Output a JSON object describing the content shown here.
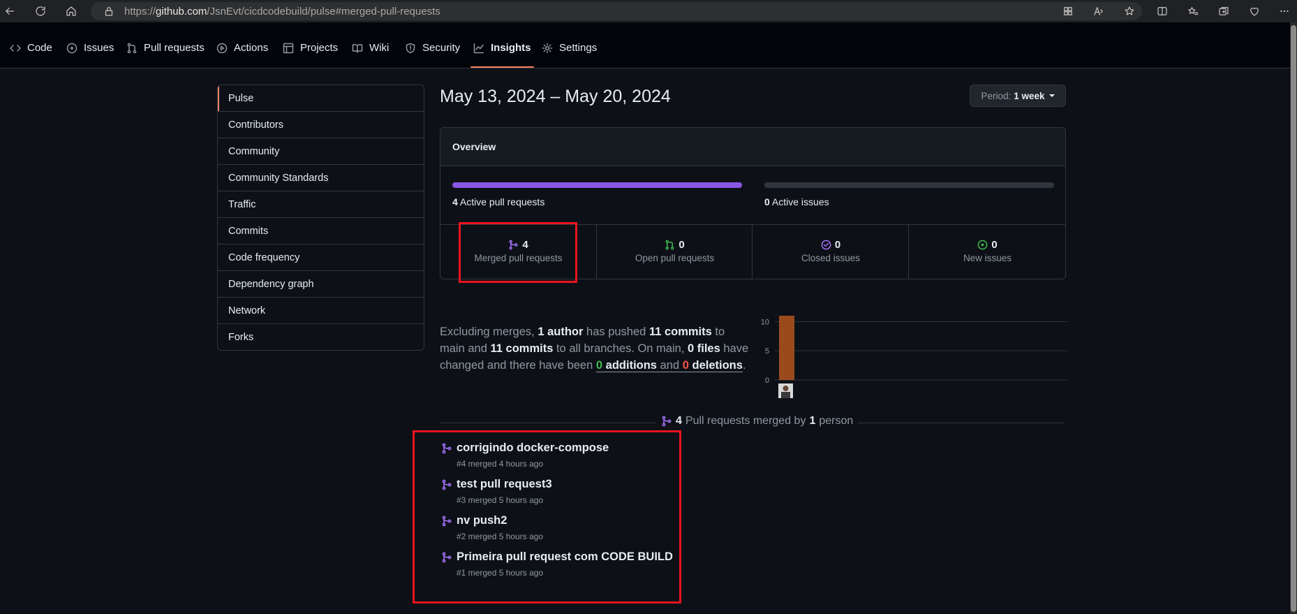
{
  "browser": {
    "url_prefix": "https://",
    "url_host": "github.com",
    "url_path": "/JsnEvt/cicdcodebuild/pulse#merged-pull-requests"
  },
  "repo_nav": {
    "tabs": [
      {
        "label": "Code",
        "icon": "code-icon"
      },
      {
        "label": "Issues",
        "icon": "issue-icon"
      },
      {
        "label": "Pull requests",
        "icon": "pull-request-icon"
      },
      {
        "label": "Actions",
        "icon": "play-icon"
      },
      {
        "label": "Projects",
        "icon": "table-icon"
      },
      {
        "label": "Wiki",
        "icon": "book-icon"
      },
      {
        "label": "Security",
        "icon": "shield-icon"
      },
      {
        "label": "Insights",
        "icon": "graph-icon",
        "active": true
      },
      {
        "label": "Settings",
        "icon": "gear-icon"
      }
    ]
  },
  "sidebar": {
    "items": [
      {
        "label": "Pulse",
        "active": true
      },
      {
        "label": "Contributors"
      },
      {
        "label": "Community"
      },
      {
        "label": "Community Standards"
      },
      {
        "label": "Traffic"
      },
      {
        "label": "Commits"
      },
      {
        "label": "Code frequency"
      },
      {
        "label": "Dependency graph"
      },
      {
        "label": "Network"
      },
      {
        "label": "Forks"
      }
    ]
  },
  "header": {
    "date_range": "May 13, 2024 – May 20, 2024",
    "period_label": "Period:",
    "period_value": "1 week"
  },
  "overview": {
    "title": "Overview",
    "active_prs_count": "4",
    "active_prs_label": "Active pull requests",
    "active_prs_fill": 1.0,
    "active_issues_count": "0",
    "active_issues_label": "Active issues",
    "active_issues_fill": 0.0,
    "stats": [
      {
        "count": "4",
        "label": "Merged pull requests",
        "icon": "git-merge-icon",
        "color": "#a371f7"
      },
      {
        "count": "0",
        "label": "Open pull requests",
        "icon": "git-pull-request-icon",
        "color": "#3fb950"
      },
      {
        "count": "0",
        "label": "Closed issues",
        "icon": "issue-closed-icon",
        "color": "#a371f7"
      },
      {
        "count": "0",
        "label": "New issues",
        "icon": "issue-opened-icon",
        "color": "#3fb950"
      }
    ]
  },
  "summary": {
    "t1": "Excluding merges,",
    "authors": "1 author",
    "t2": "has pushed",
    "commits_main": "11 commits",
    "t3": "to main and",
    "commits_all": "11 commits",
    "t4": "to all branches. On main,",
    "files": "0 files",
    "t5": "have changed and there have been",
    "additions_count": "0",
    "additions_word": "additions",
    "t6": "and",
    "deletions_count": "0",
    "deletions_word": "deletions",
    "t7": "."
  },
  "chart_data": {
    "type": "bar",
    "categories": [
      "author"
    ],
    "values": [
      11
    ],
    "ylim": [
      0,
      11
    ],
    "yticks": [
      "10",
      "5",
      "0"
    ],
    "bar_color": "#9a4b1e",
    "grid": true
  },
  "merged": {
    "count": "4",
    "text1": "Pull requests merged by",
    "people": "1",
    "text2": "person",
    "items": [
      {
        "title": "corrigindo docker-compose",
        "meta": "#4 merged 4 hours ago"
      },
      {
        "title": "test pull request3",
        "meta": "#3 merged 5 hours ago"
      },
      {
        "title": "nv push2",
        "meta": "#2 merged 5 hours ago"
      },
      {
        "title": "Primeira pull request com CODE BUILD",
        "meta": "#1 merged 5 hours ago"
      }
    ]
  },
  "colors": {
    "accent_merge": "#a371f7",
    "accent_open": "#3fb950",
    "annotation": "#e8141e",
    "tab_underline": "#f78166"
  }
}
